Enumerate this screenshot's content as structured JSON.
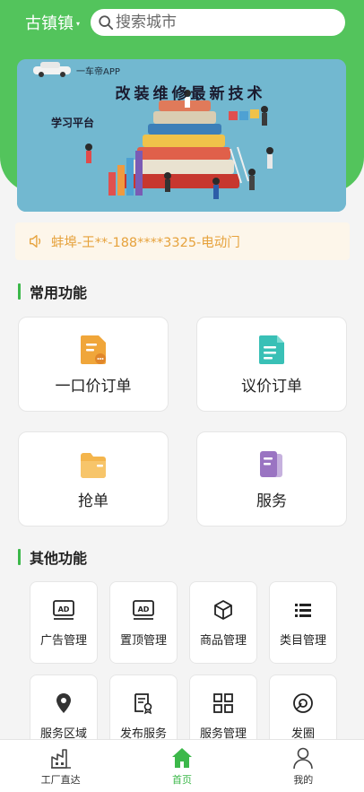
{
  "header": {
    "city": "古镇镇",
    "search_placeholder": "搜索城市"
  },
  "banner": {
    "brand": "一车帝APP",
    "headline": "改装维修最新技术",
    "platform": "学习平台"
  },
  "notice": {
    "text": "蚌埠-王**-188****3325-电动门"
  },
  "common": {
    "title": "常用功能",
    "items": [
      {
        "label": "一口价订单",
        "icon": "document-icon",
        "color": "#f0a63a"
      },
      {
        "label": "议价订单",
        "icon": "document-icon",
        "color": "#39c0b6"
      },
      {
        "label": "抢单",
        "icon": "folder-icon",
        "color": "#f4b54c"
      },
      {
        "label": "服务",
        "icon": "files-icon",
        "color": "#9a74c2"
      }
    ]
  },
  "other": {
    "title": "其他功能",
    "items": [
      {
        "label": "广告管理",
        "icon": "ad-icon"
      },
      {
        "label": "置顶管理",
        "icon": "ad-icon"
      },
      {
        "label": "商品管理",
        "icon": "box-icon"
      },
      {
        "label": "类目管理",
        "icon": "list-icon"
      },
      {
        "label": "服务区域",
        "icon": "location-icon"
      },
      {
        "label": "发布服务",
        "icon": "certificate-icon"
      },
      {
        "label": "服务管理",
        "icon": "grid-icon"
      },
      {
        "label": "发圈",
        "icon": "circle-icon"
      }
    ]
  },
  "tabbar": {
    "items": [
      {
        "label": "工厂直达",
        "icon": "factory-icon",
        "active": false
      },
      {
        "label": "首页",
        "icon": "home-icon",
        "active": true
      },
      {
        "label": "我的",
        "icon": "user-icon",
        "active": false
      }
    ]
  },
  "colors": {
    "brand_green": "#53c45c",
    "accent_green": "#3cb84a",
    "notice_text": "#e6a23c",
    "notice_bg": "#fdf6ea"
  }
}
